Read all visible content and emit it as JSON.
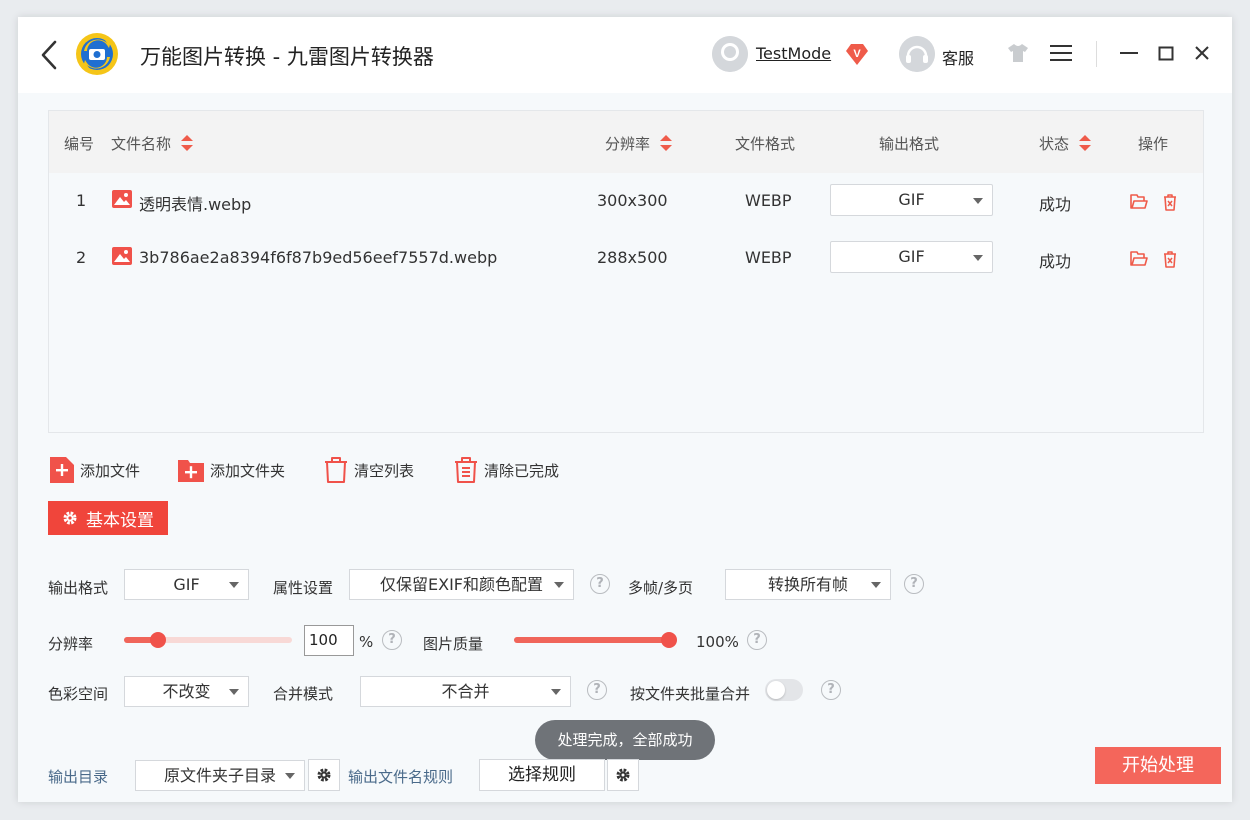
{
  "titlebar": {
    "app_title": "万能图片转换 - 九雷图片转换器",
    "username": "TestMode",
    "vip_badge": "V",
    "service_label": "客服"
  },
  "table": {
    "headers": {
      "index": "编号",
      "filename": "文件名称",
      "resolution": "分辨率",
      "file_format": "文件格式",
      "output_format": "输出格式",
      "status": "状态",
      "actions": "操作"
    },
    "rows": [
      {
        "index": "1",
        "filename": "透明表情.webp",
        "resolution": "300x300",
        "file_format": "WEBP",
        "output_format": "GIF",
        "status": "成功"
      },
      {
        "index": "2",
        "filename": "3b786ae2a8394f6f87b9ed56eef7557d.webp",
        "resolution": "288x500",
        "file_format": "WEBP",
        "output_format": "GIF",
        "status": "成功"
      }
    ]
  },
  "toolbar": {
    "add_file": "添加文件",
    "add_folder": "添加文件夹",
    "clear_list": "清空列表",
    "clear_done": "清除已完成"
  },
  "settings": {
    "tab_label": "基本设置",
    "output_format_label": "输出格式",
    "output_format_value": "GIF",
    "attribute_label": "属性设置",
    "attribute_value": "仅保留EXIF和颜色配置",
    "multiframe_label": "多帧/多页",
    "multiframe_value": "转换所有帧",
    "resolution_label": "分辨率",
    "resolution_percent": 100,
    "resolution_input": "100",
    "percent_sign": "%",
    "quality_label": "图片质量",
    "quality_percent": 100,
    "quality_text": "100%",
    "color_space_label": "色彩空间",
    "color_space_value": "不改变",
    "merge_mode_label": "合并模式",
    "merge_mode_value": "不合并",
    "folder_merge_label": "按文件夹批量合并",
    "folder_merge_on": false,
    "help_glyph": "?"
  },
  "toast": "处理完成，全部成功",
  "footer": {
    "output_dir_label": "输出目录",
    "output_dir_value": "原文件夹子目录",
    "filename_rule_label": "输出文件名规则",
    "select_rule_button": "选择规则",
    "start_button": "开始处理"
  },
  "colors": {
    "accent": "#f0453b",
    "start_button": "#f4665b",
    "toast_bg": "#6f7378",
    "blue_label": "#4a6a8a"
  }
}
